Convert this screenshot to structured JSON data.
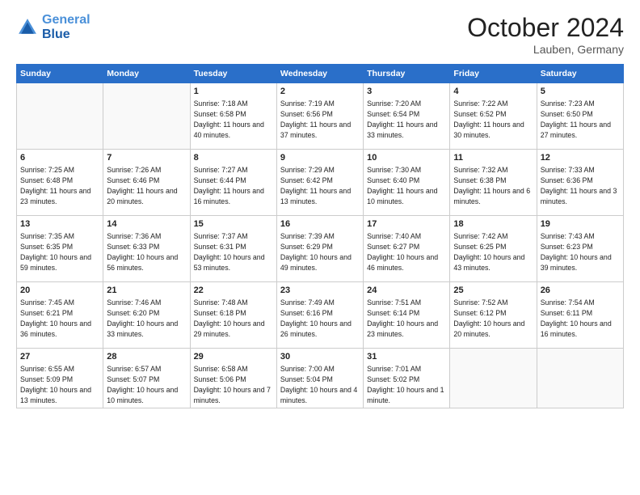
{
  "header": {
    "logo_line1": "General",
    "logo_line2": "Blue",
    "month": "October 2024",
    "location": "Lauben, Germany"
  },
  "days_of_week": [
    "Sunday",
    "Monday",
    "Tuesday",
    "Wednesday",
    "Thursday",
    "Friday",
    "Saturday"
  ],
  "weeks": [
    [
      {
        "day": "",
        "content": ""
      },
      {
        "day": "",
        "content": ""
      },
      {
        "day": "1",
        "content": "Sunrise: 7:18 AM\nSunset: 6:58 PM\nDaylight: 11 hours and 40 minutes."
      },
      {
        "day": "2",
        "content": "Sunrise: 7:19 AM\nSunset: 6:56 PM\nDaylight: 11 hours and 37 minutes."
      },
      {
        "day": "3",
        "content": "Sunrise: 7:20 AM\nSunset: 6:54 PM\nDaylight: 11 hours and 33 minutes."
      },
      {
        "day": "4",
        "content": "Sunrise: 7:22 AM\nSunset: 6:52 PM\nDaylight: 11 hours and 30 minutes."
      },
      {
        "day": "5",
        "content": "Sunrise: 7:23 AM\nSunset: 6:50 PM\nDaylight: 11 hours and 27 minutes."
      }
    ],
    [
      {
        "day": "6",
        "content": "Sunrise: 7:25 AM\nSunset: 6:48 PM\nDaylight: 11 hours and 23 minutes."
      },
      {
        "day": "7",
        "content": "Sunrise: 7:26 AM\nSunset: 6:46 PM\nDaylight: 11 hours and 20 minutes."
      },
      {
        "day": "8",
        "content": "Sunrise: 7:27 AM\nSunset: 6:44 PM\nDaylight: 11 hours and 16 minutes."
      },
      {
        "day": "9",
        "content": "Sunrise: 7:29 AM\nSunset: 6:42 PM\nDaylight: 11 hours and 13 minutes."
      },
      {
        "day": "10",
        "content": "Sunrise: 7:30 AM\nSunset: 6:40 PM\nDaylight: 11 hours and 10 minutes."
      },
      {
        "day": "11",
        "content": "Sunrise: 7:32 AM\nSunset: 6:38 PM\nDaylight: 11 hours and 6 minutes."
      },
      {
        "day": "12",
        "content": "Sunrise: 7:33 AM\nSunset: 6:36 PM\nDaylight: 11 hours and 3 minutes."
      }
    ],
    [
      {
        "day": "13",
        "content": "Sunrise: 7:35 AM\nSunset: 6:35 PM\nDaylight: 10 hours and 59 minutes."
      },
      {
        "day": "14",
        "content": "Sunrise: 7:36 AM\nSunset: 6:33 PM\nDaylight: 10 hours and 56 minutes."
      },
      {
        "day": "15",
        "content": "Sunrise: 7:37 AM\nSunset: 6:31 PM\nDaylight: 10 hours and 53 minutes."
      },
      {
        "day": "16",
        "content": "Sunrise: 7:39 AM\nSunset: 6:29 PM\nDaylight: 10 hours and 49 minutes."
      },
      {
        "day": "17",
        "content": "Sunrise: 7:40 AM\nSunset: 6:27 PM\nDaylight: 10 hours and 46 minutes."
      },
      {
        "day": "18",
        "content": "Sunrise: 7:42 AM\nSunset: 6:25 PM\nDaylight: 10 hours and 43 minutes."
      },
      {
        "day": "19",
        "content": "Sunrise: 7:43 AM\nSunset: 6:23 PM\nDaylight: 10 hours and 39 minutes."
      }
    ],
    [
      {
        "day": "20",
        "content": "Sunrise: 7:45 AM\nSunset: 6:21 PM\nDaylight: 10 hours and 36 minutes."
      },
      {
        "day": "21",
        "content": "Sunrise: 7:46 AM\nSunset: 6:20 PM\nDaylight: 10 hours and 33 minutes."
      },
      {
        "day": "22",
        "content": "Sunrise: 7:48 AM\nSunset: 6:18 PM\nDaylight: 10 hours and 29 minutes."
      },
      {
        "day": "23",
        "content": "Sunrise: 7:49 AM\nSunset: 6:16 PM\nDaylight: 10 hours and 26 minutes."
      },
      {
        "day": "24",
        "content": "Sunrise: 7:51 AM\nSunset: 6:14 PM\nDaylight: 10 hours and 23 minutes."
      },
      {
        "day": "25",
        "content": "Sunrise: 7:52 AM\nSunset: 6:12 PM\nDaylight: 10 hours and 20 minutes."
      },
      {
        "day": "26",
        "content": "Sunrise: 7:54 AM\nSunset: 6:11 PM\nDaylight: 10 hours and 16 minutes."
      }
    ],
    [
      {
        "day": "27",
        "content": "Sunrise: 6:55 AM\nSunset: 5:09 PM\nDaylight: 10 hours and 13 minutes."
      },
      {
        "day": "28",
        "content": "Sunrise: 6:57 AM\nSunset: 5:07 PM\nDaylight: 10 hours and 10 minutes."
      },
      {
        "day": "29",
        "content": "Sunrise: 6:58 AM\nSunset: 5:06 PM\nDaylight: 10 hours and 7 minutes."
      },
      {
        "day": "30",
        "content": "Sunrise: 7:00 AM\nSunset: 5:04 PM\nDaylight: 10 hours and 4 minutes."
      },
      {
        "day": "31",
        "content": "Sunrise: 7:01 AM\nSunset: 5:02 PM\nDaylight: 10 hours and 1 minute."
      },
      {
        "day": "",
        "content": ""
      },
      {
        "day": "",
        "content": ""
      }
    ]
  ]
}
